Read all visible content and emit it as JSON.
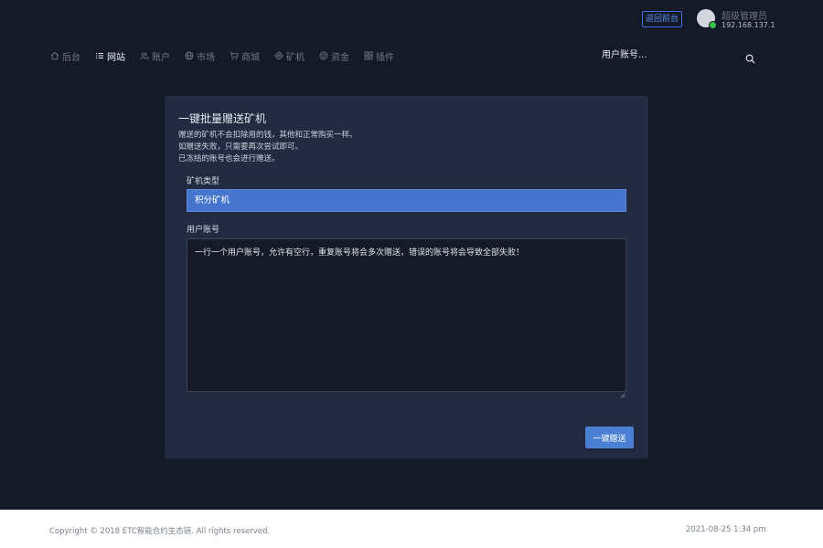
{
  "header": {
    "back_button_label": "返回前台",
    "user_name": "超级管理员",
    "user_ip": "192.168.137.1",
    "status_color": "#39c24a",
    "accent_color": "#3b6fd6"
  },
  "nav": {
    "items": [
      {
        "label": "后台",
        "icon": "home-icon",
        "active": false
      },
      {
        "label": "网站",
        "icon": "list-icon",
        "active": true
      },
      {
        "label": "账户",
        "icon": "users-icon",
        "active": false
      },
      {
        "label": "市场",
        "icon": "globe-icon",
        "active": false
      },
      {
        "label": "商城",
        "icon": "cart-icon",
        "active": false
      },
      {
        "label": "矿机",
        "icon": "gear-icon",
        "active": false
      },
      {
        "label": "资金",
        "icon": "coin-icon",
        "active": false
      },
      {
        "label": "插件",
        "icon": "grid-icon",
        "active": false
      }
    ],
    "search_placeholder": "用户账号..."
  },
  "form": {
    "title": "一键批量赠送矿机",
    "description": [
      "赠送的矿机不会扣除用的钱，其他和正常购买一样。",
      "如赠送失败，只需要再次尝试即可。",
      "已冻结的账号也会进行赠送。"
    ],
    "type_label": "矿机类型",
    "type_value": "积分矿机",
    "account_label": "用户账号",
    "account_placeholder": "一行一个用户账号，允许有空行，重复账号将会多次赠送，错误的账号将会导致全部失败！",
    "submit_label": "一键赠送",
    "button_color": "#4a7fd4"
  },
  "footer": {
    "copyright": "Copyright © 2018 ETC智能合约生态链. All rights reserved.",
    "datetime": "2021-08-25 1:34 pm"
  }
}
